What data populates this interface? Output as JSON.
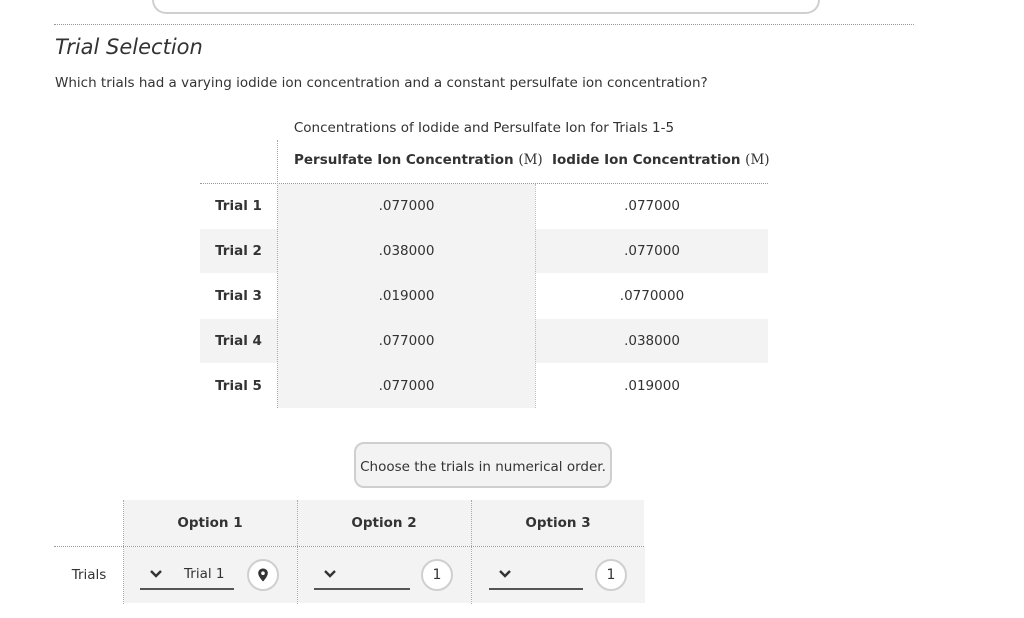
{
  "section_title": "Trial Selection",
  "question": "Which trials had a varying iodide ion concentration and a constant persulfate ion concentration?",
  "table": {
    "caption": "Concentrations of Iodide and Persulfate Ion for Trials 1-5",
    "headers": {
      "persulfate_label": "Persulfate Ion Concentration",
      "iodide_label": "Iodide Ion Concentration",
      "unit": "(M)"
    },
    "rows": [
      {
        "label": "Trial 1",
        "persulfate": ".077000",
        "iodide": ".077000"
      },
      {
        "label": "Trial 2",
        "persulfate": ".038000",
        "iodide": ".077000"
      },
      {
        "label": "Trial 3",
        "persulfate": ".019000",
        "iodide": ".0770000"
      },
      {
        "label": "Trial 4",
        "persulfate": ".077000",
        "iodide": ".038000"
      },
      {
        "label": "Trial 5",
        "persulfate": ".077000",
        "iodide": ".019000"
      }
    ]
  },
  "hint": "Choose the trials in numerical order.",
  "answer": {
    "row_label": "Trials",
    "options": [
      {
        "header": "Option 1",
        "selected": "Trial 1",
        "badge": "location-pin-icon"
      },
      {
        "header": "Option 2",
        "selected": "",
        "badge": "1"
      },
      {
        "header": "Option 3",
        "selected": "",
        "badge": "1"
      }
    ]
  }
}
